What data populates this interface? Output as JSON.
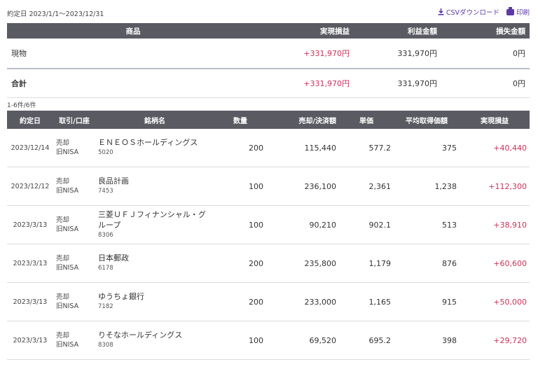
{
  "header": {
    "period": "約定日 2023/1/1〜2023/12/31",
    "csv_label": "CSVダウンロード",
    "print_label": "印刷"
  },
  "summary": {
    "headers": [
      "商品",
      "実現損益",
      "利益金額",
      "損失金額"
    ],
    "rows": [
      {
        "label": "現物",
        "realized": "+331,970円",
        "profit": "331,970円",
        "loss": "0円"
      }
    ],
    "total": {
      "label": "合計",
      "realized": "+331,970円",
      "profit": "331,970円",
      "loss": "0円"
    }
  },
  "count": "1-6件/6件",
  "detail": {
    "headers": [
      "約定日",
      "取引/口座",
      "銘柄名",
      "数量",
      "売却/決済額",
      "単価",
      "平均取得価額",
      "実現損益"
    ],
    "rows": [
      {
        "date": "2023/12/14",
        "kind1": "売却",
        "kind2": "旧NISA",
        "name": "ＥＮＥＯＳホールディングス",
        "code": "5020",
        "qty": "200",
        "amount": "115,440",
        "price": "577.2",
        "avg": "375",
        "pl": "+40,440"
      },
      {
        "date": "2023/12/12",
        "kind1": "売却",
        "kind2": "旧NISA",
        "name": "良品計画",
        "code": "7453",
        "qty": "100",
        "amount": "236,100",
        "price": "2,361",
        "avg": "1,238",
        "pl": "+112,300"
      },
      {
        "date": "2023/3/13",
        "kind1": "売却",
        "kind2": "旧NISA",
        "name": "三菱ＵＦＪフィナンシャル・グループ",
        "code": "8306",
        "qty": "100",
        "amount": "90,210",
        "price": "902.1",
        "avg": "513",
        "pl": "+38,910"
      },
      {
        "date": "2023/3/13",
        "kind1": "売却",
        "kind2": "旧NISA",
        "name": "日本郵政",
        "code": "6178",
        "qty": "200",
        "amount": "235,800",
        "price": "1,179",
        "avg": "876",
        "pl": "+60,600"
      },
      {
        "date": "2023/3/13",
        "kind1": "売却",
        "kind2": "旧NISA",
        "name": "ゆうちょ銀行",
        "code": "7182",
        "qty": "200",
        "amount": "233,000",
        "price": "1,165",
        "avg": "915",
        "pl": "+50,000"
      },
      {
        "date": "2023/3/13",
        "kind1": "売却",
        "kind2": "旧NISA",
        "name": "りそなホールディングス",
        "code": "8308",
        "qty": "100",
        "amount": "69,520",
        "price": "695.2",
        "avg": "398",
        "pl": "+29,720"
      }
    ]
  },
  "colors": {
    "header_bg": "#5a5a63",
    "positive": "#c8325a",
    "link": "#5b3aa8"
  }
}
